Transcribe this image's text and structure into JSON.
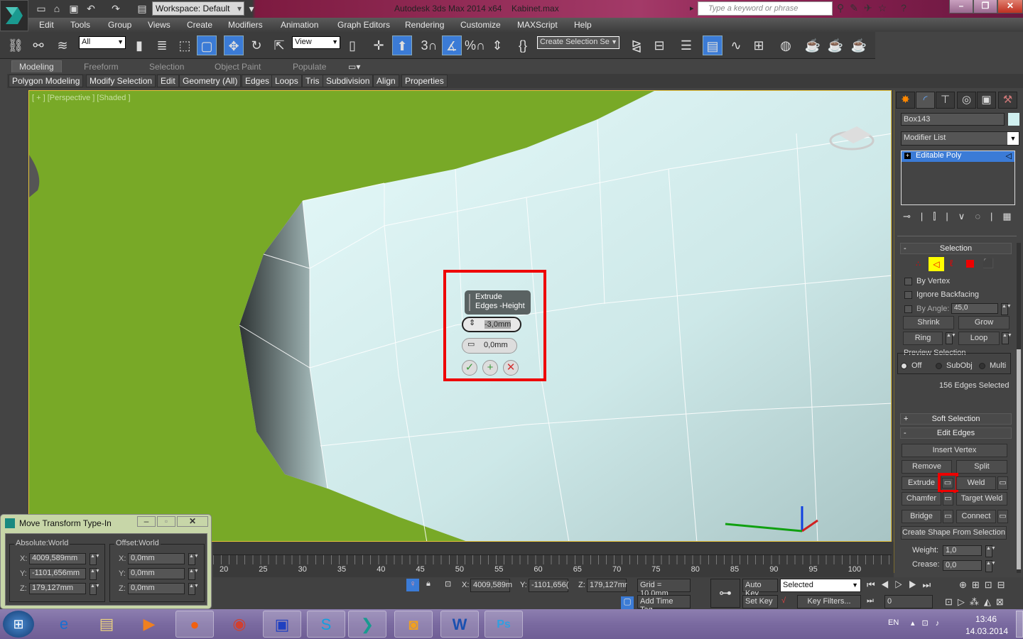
{
  "titlebar": {
    "workspace": "Workspace: Default",
    "app_title": "Autodesk 3ds Max  2014 x64",
    "file_name": "Kabinet.max",
    "search_placeholder": "Type a keyword or phrase"
  },
  "menu": [
    "Edit",
    "Tools",
    "Group",
    "Views",
    "Create",
    "Modifiers",
    "Animation",
    "Graph Editors",
    "Rendering",
    "Customize",
    "MAXScript",
    "Help"
  ],
  "toolbar": {
    "selection_filter": "All",
    "ref_coord": "View",
    "named_selection": "Create Selection Se",
    "snap_3": "3",
    "snap_percent": "%"
  },
  "ribbon": {
    "tabs": [
      "Modeling",
      "Freeform",
      "Selection",
      "Object Paint",
      "Populate"
    ],
    "active_tab": "Modeling",
    "panels": [
      "Polygon Modeling",
      "Modify Selection",
      "Edit",
      "Geometry (All)",
      "Edges",
      "Loops",
      "Tris",
      "Subdivision",
      "Align",
      "Properties"
    ]
  },
  "viewport": {
    "label": "[ + ] [Perspective ] [Shaded ]",
    "object_color": "#d4f0f0",
    "background": "#78a927"
  },
  "caddy": {
    "title": "Extrude Edges -Height",
    "height_value": "-3,0mm",
    "width_value": "0,0mm",
    "ok": "✓",
    "apply": "+",
    "cancel": "✕"
  },
  "command_panel": {
    "object_name": "Box143",
    "object_color": "#d0f0f0",
    "modifier_list": "Modifier List",
    "stack_item": "Editable Poly",
    "selection": {
      "title": "Selection",
      "by_vertex": "By Vertex",
      "ignore_backfacing": "Ignore Backfacing",
      "by_angle": "By Angle:",
      "angle_value": "45,0",
      "shrink": "Shrink",
      "grow": "Grow",
      "ring": "Ring",
      "loop": "Loop",
      "preview_selection": "Preview Selection",
      "preview_options": [
        "Off",
        "SubObj",
        "Multi"
      ],
      "preview_selected": "Off",
      "status": "156 Edges Selected"
    },
    "soft_selection": "Soft Selection",
    "edit_edges": {
      "title": "Edit Edges",
      "insert_vertex": "Insert Vertex",
      "remove": "Remove",
      "split": "Split",
      "extrude": "Extrude",
      "weld": "Weld",
      "chamfer": "Chamfer",
      "target_weld": "Target Weld",
      "bridge": "Bridge",
      "connect": "Connect",
      "create_shape": "Create Shape From Selection",
      "weight_label": "Weight:",
      "weight": "1,0",
      "crease_label": "Crease:",
      "crease": "0,0"
    }
  },
  "timeline": {
    "ticks": [
      "20",
      "25",
      "30",
      "35",
      "40",
      "45",
      "50",
      "55",
      "60",
      "65",
      "70",
      "75",
      "80",
      "85",
      "90",
      "95",
      "100"
    ]
  },
  "statusbar": {
    "x": "4009,589m",
    "y": "-1101,656(",
    "z": "179,127mr",
    "grid": "Grid = 10,0mm",
    "add_time_tag": "Add Time Tag",
    "auto_key": "Auto Key",
    "set_key": "Set Key",
    "key_mode": "Selected",
    "key_filters": "Key Filters...",
    "frame": "0"
  },
  "dialog": {
    "title": "Move Transform Type-In",
    "absolute_label": "Absolute:World",
    "offset_label": "Offset:World",
    "abs": {
      "x": "4009,589mm",
      "y": "-1101,656mm",
      "z": "179,127mm"
    },
    "offset": {
      "x": "0,0mm",
      "y": "0,0mm",
      "z": "0,0mm"
    },
    "axis_x": "X:",
    "axis_y": "Y:",
    "axis_z": "Z:"
  },
  "taskbar": {
    "language": "EN",
    "time": "13:46",
    "date": "14.03.2014"
  }
}
